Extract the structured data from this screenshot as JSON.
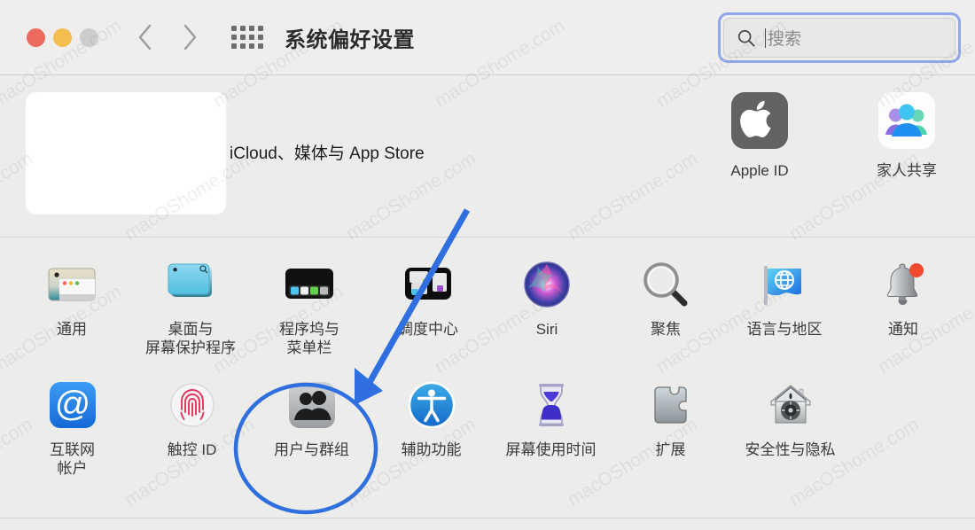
{
  "window": {
    "title": "系统偏好设置",
    "traffic_lights": [
      {
        "name": "close",
        "color": "#ec6b5e"
      },
      {
        "name": "minimize",
        "color": "#f4bd4f"
      },
      {
        "name": "zoom",
        "color": "#cdcdcd"
      }
    ],
    "nav": {
      "back_label": "‹",
      "forward_label": "›",
      "grid_label": "全部显示"
    }
  },
  "search": {
    "placeholder": "搜索",
    "value": "",
    "icon": "search-icon",
    "focus_color": "#8fa8ec"
  },
  "banner": {
    "subtitle": "iCloud、媒体与 App Store",
    "redacted": true,
    "tiles": [
      {
        "label": "Apple ID",
        "icon": "apple-logo-icon"
      },
      {
        "label": "家人共享",
        "icon": "family-sharing-icon"
      }
    ]
  },
  "grid": {
    "rows": [
      [
        {
          "label": "通用",
          "icon": "general-icon"
        },
        {
          "label": "桌面与\n屏幕保护程序",
          "icon": "desktop-screensaver-icon"
        },
        {
          "label": "程序坞与\n菜单栏",
          "icon": "dock-menubar-icon"
        },
        {
          "label": "调度中心",
          "icon": "mission-control-icon"
        },
        {
          "label": "Siri",
          "icon": "siri-icon"
        },
        {
          "label": "聚焦",
          "icon": "spotlight-icon"
        },
        {
          "label": "语言与地区",
          "icon": "language-region-icon"
        },
        {
          "label": "通知",
          "icon": "notifications-icon"
        }
      ],
      [
        {
          "label": "互联网\n帐户",
          "icon": "internet-accounts-icon"
        },
        {
          "label": "触控 ID",
          "icon": "touch-id-icon"
        },
        {
          "label": "用户与群组",
          "icon": "users-groups-icon",
          "highlighted": true
        },
        {
          "label": "辅助功能",
          "icon": "accessibility-icon"
        },
        {
          "label": "屏幕使用时间",
          "icon": "screen-time-icon"
        },
        {
          "label": "扩展",
          "icon": "extensions-icon"
        },
        {
          "label": "安全性与隐私",
          "icon": "security-privacy-icon"
        }
      ]
    ]
  },
  "annotation": {
    "color": "#2f6fe0",
    "highlight_target": "用户与群组",
    "shapes": [
      "arrow",
      "ellipse"
    ]
  },
  "watermark": {
    "text": "macOShome.com",
    "color": "rgba(120,120,120,0.13)"
  }
}
